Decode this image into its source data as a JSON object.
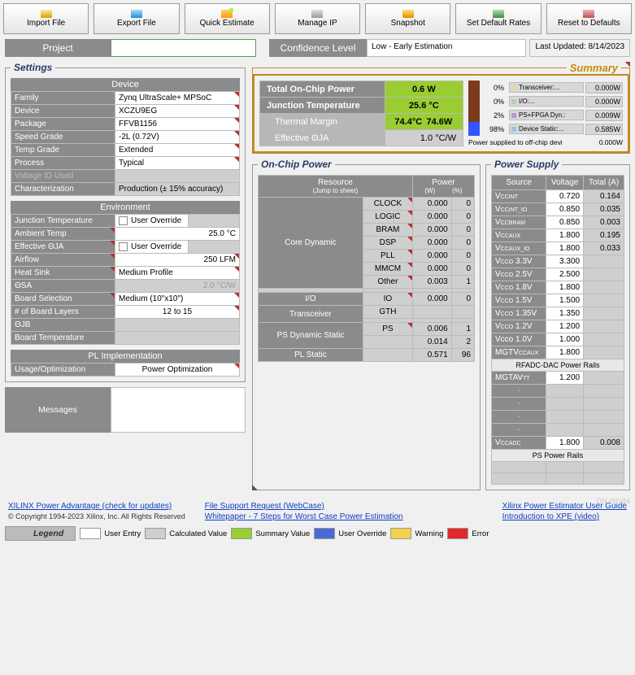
{
  "toolbar": {
    "import": "Import File",
    "export": "Export File",
    "quick": "Quick Estimate",
    "manage": "Manage IP",
    "snapshot": "Snapshot",
    "setrates": "Set Default Rates",
    "reset": "Reset to Defaults"
  },
  "top": {
    "project_label": "Project",
    "project_value": "",
    "conf_label": "Confidence Level",
    "conf_value": "Low - Early Estimation",
    "last_updated": "Last Updated: 8/14/2023"
  },
  "settings_title": "Settings",
  "device_head": "Device",
  "device": {
    "family_k": "Family",
    "family_v": "Zynq UltraScale+ MPSoC",
    "device_k": "Device",
    "device_v": "XCZU9EG",
    "package_k": "Package",
    "package_v": "FFVB1156",
    "speed_k": "Speed Grade",
    "speed_v": "-2L (0.72V)",
    "temp_k": "Temp Grade",
    "temp_v": "Extended",
    "process_k": "Process",
    "process_v": "Typical",
    "vid_k": "Voltage ID Used",
    "vid_v": "",
    "char_k": "Characterization",
    "char_v": "Production (± 15% accuracy)"
  },
  "env_head": "Environment",
  "env": {
    "jt_k": "Junction Temperature",
    "jt_override": "User Override",
    "jt_v": "",
    "amb_k": "Ambient Temp",
    "amb_v": "25.0 °C",
    "eja_k": "Effective ΘJA",
    "eja_override": "User Override",
    "eja_v": "",
    "air_k": "Airflow",
    "air_v": "250 LFM",
    "hs_k": "Heat Sink",
    "hs_v": "Medium Profile",
    "osa_k": "  ΘSA",
    "osa_v": "2.0 °C/W",
    "bs_k": "Board Selection",
    "bs_v": "Medium (10\"x10\")",
    "bl_k": "  # of Board Layers",
    "bl_v": "12 to 15",
    "ojb_k": "  ΘJB",
    "ojb_v": "",
    "bt_k": "Board Temperature",
    "bt_v": ""
  },
  "pl_head": "PL Implementation",
  "pl": {
    "uo_k": "Usage/Optimization",
    "uo_v": "Power Optimization"
  },
  "messages_label": "Messages",
  "summary_title": "Summary",
  "sum": {
    "tocp_k": "Total On-Chip Power",
    "tocp_v": "0.6 W",
    "jt_k": "Junction Temperature",
    "jt_v": "25.6 °C",
    "tm_k": "Thermal Margin",
    "tm_v1": "74.4°C",
    "tm_v2": "74.6W",
    "eja_k": "Effective ΘJA",
    "eja_v": "1.0 °C/W"
  },
  "sumlegend": [
    {
      "swatch": "#7a3b1e",
      "pct": "0%",
      "bulletcolor": "#e9d6a8",
      "name": "Transceiver:...",
      "w": "0.000W"
    },
    {
      "swatch": "#7a3b1e",
      "pct": "0%",
      "bulletcolor": "#b1cfae",
      "name": "I/O:...",
      "w": "0.000W"
    },
    {
      "swatch": "#7a3b1e",
      "pct": "2%",
      "bulletcolor": "#b29ad0",
      "name": "PS+FPGA Dyn.:",
      "w": "0.009W"
    },
    {
      "swatch": "#3355ff",
      "pct": "98%",
      "bulletcolor": "#9ec1e5",
      "name": "Device Static:...",
      "w": "0.585W"
    }
  ],
  "sup_line": {
    "label": "Power supplied to off-chip devi",
    "w": "0.000W"
  },
  "ocp_title": "On-Chip Power",
  "ocp": {
    "h_res": "Resource",
    "h_jump": "(Jump to sheet)",
    "h_pow": "Power",
    "h_w": "(W)",
    "h_pc": "(%)",
    "cat_core": "Core Dynamic",
    "cat_io": "I/O",
    "cat_tx": "Transceiver",
    "cat_ps": "PS Dynamic Static",
    "cat_pl": "PL Static",
    "rows": [
      {
        "j": "CLOCK",
        "w": "0.000",
        "p": "0"
      },
      {
        "j": "LOGIC",
        "w": "0.000",
        "p": "0"
      },
      {
        "j": "BRAM",
        "w": "0.000",
        "p": "0"
      },
      {
        "j": "DSP",
        "w": "0.000",
        "p": "0"
      },
      {
        "j": "PLL",
        "w": "0.000",
        "p": "0"
      },
      {
        "j": "MMCM",
        "w": "0.000",
        "p": "0"
      },
      {
        "j": "Other",
        "w": "0.003",
        "p": "1"
      }
    ],
    "io": {
      "j": "IO",
      "w": "0.000",
      "p": "0"
    },
    "tx": {
      "j": "GTH",
      "w": "",
      "p": ""
    },
    "ps": {
      "j": "PS",
      "w": "0.006",
      "p": "1"
    },
    "psstatic": {
      "w": "0.014",
      "p": "2"
    },
    "plstatic": {
      "w": "0.571",
      "p": "96"
    }
  },
  "ps_title": "Power Supply",
  "ps": {
    "h_src": "Source",
    "h_v": "Voltage",
    "h_t": "Total (A)",
    "rows": [
      {
        "s": "V",
        "sub": "CCINT",
        "v": "0.720",
        "t": "0.164"
      },
      {
        "s": "V",
        "sub": "CCINT_IO",
        "v": "0.850",
        "t": "0.035"
      },
      {
        "s": "V",
        "sub": "CCBRAM",
        "v": "0.850",
        "t": "0.003"
      },
      {
        "s": "V",
        "sub": "CCAUX",
        "v": "1.800",
        "t": "0.195"
      },
      {
        "s": "V",
        "sub": "CCAUX_IO",
        "v": "1.800",
        "t": "0.033"
      },
      {
        "s": "V",
        "sub": "CCO",
        " suffix": "3.3V",
        "v": "3.300",
        "t": ""
      },
      {
        "s": "V",
        "sub": "CCO",
        " suffix": "2.5V",
        "v": "2.500",
        "t": ""
      },
      {
        "s": "V",
        "sub": "CCO",
        " suffix": "1.8V",
        "v": "1.800",
        "t": ""
      },
      {
        "s": "V",
        "sub": "CCO",
        " suffix": "1.5V",
        "v": "1.500",
        "t": ""
      },
      {
        "s": "V",
        "sub": "CCO",
        " suffix": "1.35V",
        "v": "1.350",
        "t": ""
      },
      {
        "s": "V",
        "sub": "CCO",
        " suffix": "1.2V",
        "v": "1.200",
        "t": ""
      },
      {
        "s": "Vcco 1.0V",
        "sub": "",
        "v": "1.000",
        "t": ""
      },
      {
        "s": "MGTV",
        "sub": "CCAUX",
        "v": "1.800",
        "t": ""
      }
    ],
    "rfhead": "RFADC-DAC Power Rails",
    "mgtav": {
      "s": "MGTAV",
      "sub": "TT",
      "v": "1.200",
      "t": ""
    },
    "vccadc": {
      "s": "V",
      "sub": "CCADC",
      "v": "1.800",
      "t": "0.008"
    },
    "pshead": "PS Power Rails",
    "dash": "-"
  },
  "links": {
    "power_adv": "XILINX Power Advantage (check for updates)",
    "copy": "© Copyright 1994-2023 Xilinx, Inc. All Rights Reserved",
    "filesupp": "File Support Request (WebCase)",
    "white": "Whitepaper - 7 Steps for Worst Case Power Estimation",
    "userguide": "Xilinx Power Estimator User Guide",
    "intro": "Introduction to XPE (video)",
    "wm": "DN @hi94"
  },
  "legstrip": {
    "title": "Legend",
    "items": [
      {
        "c": "#ffffff",
        "t": "User Entry"
      },
      {
        "c": "#cfcfcf",
        "t": "Calculated Value"
      },
      {
        "c": "#9acd32",
        "t": "Summary Value"
      },
      {
        "c": "#4a6bd6",
        "t": "User Override"
      },
      {
        "c": "#f2d24a",
        "t": "Warning"
      },
      {
        "c": "#e02a2a",
        "t": "Error"
      }
    ]
  }
}
